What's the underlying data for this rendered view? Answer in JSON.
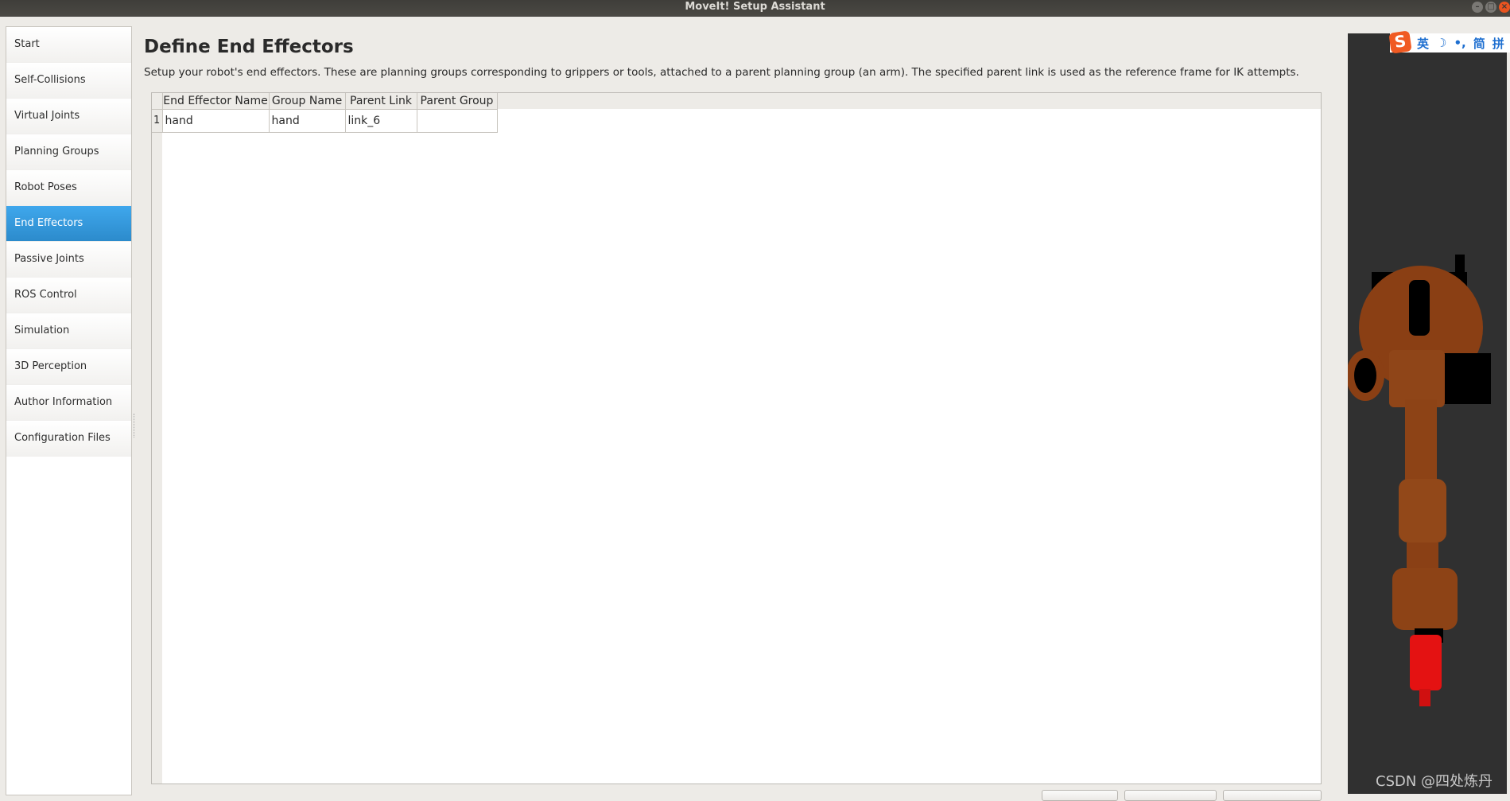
{
  "window": {
    "title": "MoveIt! Setup Assistant",
    "controls": {
      "minimize": "–",
      "maximize": "□",
      "close": "×"
    }
  },
  "sidebar": {
    "items": [
      {
        "label": "Start",
        "active": false
      },
      {
        "label": "Self-Collisions",
        "active": false
      },
      {
        "label": "Virtual Joints",
        "active": false
      },
      {
        "label": "Planning Groups",
        "active": false
      },
      {
        "label": "Robot Poses",
        "active": false
      },
      {
        "label": "End Effectors",
        "active": true
      },
      {
        "label": "Passive Joints",
        "active": false
      },
      {
        "label": "ROS Control",
        "active": false
      },
      {
        "label": "Simulation",
        "active": false
      },
      {
        "label": "3D Perception",
        "active": false
      },
      {
        "label": "Author Information",
        "active": false
      },
      {
        "label": "Configuration Files",
        "active": false
      }
    ]
  },
  "main": {
    "title": "Define End Effectors",
    "description": "Setup your robot's end effectors. These are planning groups corresponding to grippers or tools, attached to a parent planning group (an arm). The specified parent link is used as the reference frame for IK attempts.",
    "table": {
      "columns": [
        "End Effector Name",
        "Group Name",
        "Parent Link",
        "Parent Group"
      ],
      "rows": [
        {
          "index": "1",
          "cells": [
            "hand",
            "hand",
            "link_6",
            ""
          ]
        }
      ]
    }
  },
  "ime_bar": {
    "logo": "S",
    "items": [
      "英",
      "☽",
      "•,",
      "简",
      "拼"
    ]
  },
  "watermark": "CSDN @四处炼丹",
  "colors": {
    "accent": "#2f95db",
    "robot_body": "#8a3f14",
    "end_effector": "#e01010",
    "viewer_bg": "#303030"
  }
}
